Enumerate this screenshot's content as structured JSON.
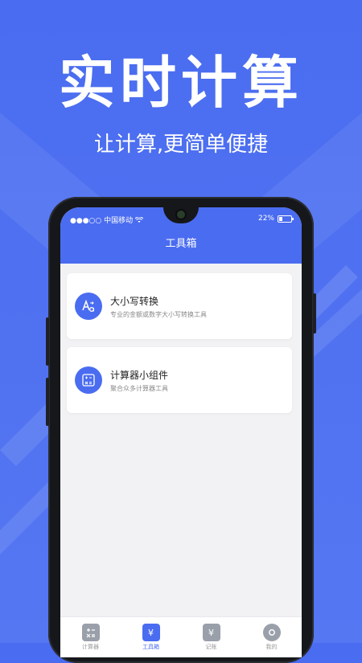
{
  "promo": {
    "title": "实时计算",
    "subtitle": "让计算,更简单便捷"
  },
  "status_bar": {
    "carrier": "●●●○○ 中国移动",
    "battery": "22%"
  },
  "header": {
    "title": "工具箱"
  },
  "tools": [
    {
      "title": "大小写转换",
      "desc": "专业的金额或数字大小写转换工具",
      "icon": "text-case-icon"
    },
    {
      "title": "计算器小组件",
      "desc": "聚合众多计算器工具",
      "icon": "calculator-icon"
    }
  ],
  "tabs": [
    {
      "label": "计算器",
      "icon": "calculator-icon",
      "active": false
    },
    {
      "label": "工具箱",
      "icon": "yen-toolbox-icon",
      "active": true
    },
    {
      "label": "记账",
      "icon": "yen-ledger-icon",
      "active": false
    },
    {
      "label": "我的",
      "icon": "gear-icon",
      "active": false
    }
  ],
  "colors": {
    "accent": "#4a6cf0",
    "background": "#f2f2f5",
    "inactive": "#9aa0aa"
  }
}
